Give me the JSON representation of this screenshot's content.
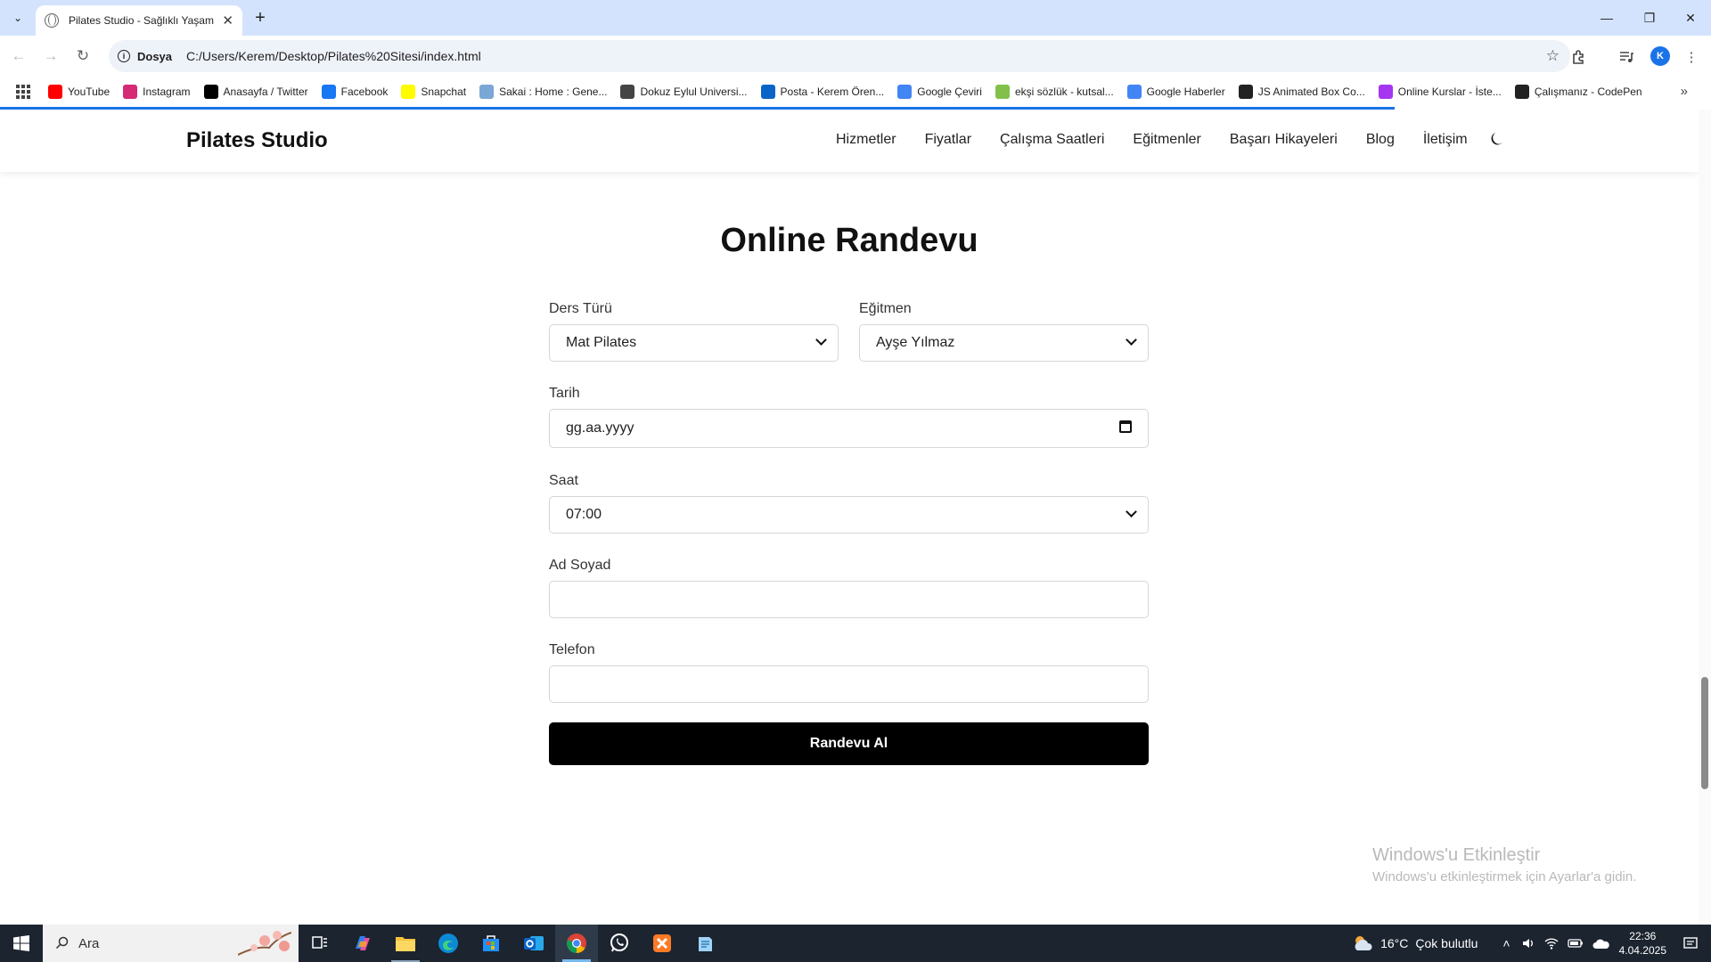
{
  "browser": {
    "tab": {
      "title": "Pilates Studio - Sağlıklı Yaşamın"
    },
    "omnibox": {
      "scheme_label": "Dosya",
      "url": "C:/Users/Kerem/Desktop/Pilates%20Sitesi/index.html"
    },
    "profile_initial": "K",
    "bookmarks": [
      {
        "label": "YouTube",
        "icon": "youtube-icon",
        "color": "#ff0000"
      },
      {
        "label": "Instagram",
        "icon": "instagram-icon",
        "color": "#d62976"
      },
      {
        "label": "Anasayfa / Twitter",
        "icon": "x-icon",
        "color": "#000000"
      },
      {
        "label": "Facebook",
        "icon": "facebook-icon",
        "color": "#1877f2"
      },
      {
        "label": "Snapchat",
        "icon": "snapchat-icon",
        "color": "#fffc00"
      },
      {
        "label": "Sakai : Home : Gene...",
        "icon": "sakai-icon",
        "color": "#7aa7d6"
      },
      {
        "label": "Dokuz Eylul Universi...",
        "icon": "globe-icon",
        "color": "#444444"
      },
      {
        "label": "Posta - Kerem Ören...",
        "icon": "outlook-icon",
        "color": "#0a64c8"
      },
      {
        "label": "Google Çeviri",
        "icon": "translate-icon",
        "color": "#4285f4"
      },
      {
        "label": "ekşi sözlük - kutsal...",
        "icon": "eksi-icon",
        "color": "#81c14b"
      },
      {
        "label": "Google Haberler",
        "icon": "news-icon",
        "color": "#4285f4"
      },
      {
        "label": "JS Animated Box Co...",
        "icon": "codepen-circle-icon",
        "color": "#222222"
      },
      {
        "label": "Online Kurslar - İste...",
        "icon": "udemy-icon",
        "color": "#a435f0"
      },
      {
        "label": "Çalışmanız - CodePen",
        "icon": "codepen-icon",
        "color": "#222222"
      }
    ]
  },
  "site": {
    "brand": "Pilates Studio",
    "nav": [
      "Hizmetler",
      "Fiyatlar",
      "Çalışma Saatleri",
      "Eğitmenler",
      "Başarı Hikayeleri",
      "Blog",
      "İletişim"
    ],
    "theme_icon": "moon-icon"
  },
  "booking": {
    "title": "Online Randevu",
    "class_type": {
      "label": "Ders Türü",
      "value": "Mat Pilates"
    },
    "instructor": {
      "label": "Eğitmen",
      "value": "Ayşe Yılmaz"
    },
    "date": {
      "label": "Tarih",
      "value": "gg.aa.yyyy"
    },
    "time": {
      "label": "Saat",
      "value": "07:00"
    },
    "name": {
      "label": "Ad Soyad",
      "value": ""
    },
    "phone": {
      "label": "Telefon",
      "value": ""
    },
    "submit": "Randevu Al"
  },
  "watermark": {
    "line1": "Windows'u Etkinleştir",
    "line2": "Windows'u etkinleştirmek için Ayarlar'a gidin."
  },
  "taskbar": {
    "search_placeholder": "Ara",
    "weather": {
      "temp": "16°C",
      "desc": "Çok bulutlu"
    },
    "time": "22:36",
    "date": "4.04.2025"
  },
  "colors": {
    "accent": "#000000",
    "chrome": "#d3e3fd",
    "taskbar": "#1c2430"
  }
}
